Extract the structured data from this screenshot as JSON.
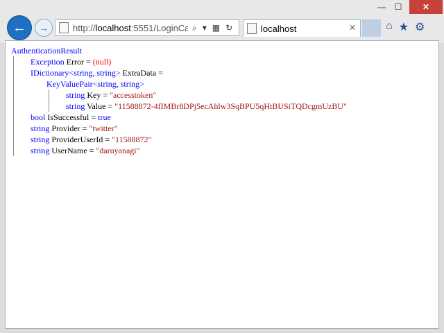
{
  "window": {
    "minimize_label": "—",
    "maximize_label": "☐",
    "close_label": "✕"
  },
  "nav": {
    "back_icon": "←",
    "forward_icon": "→",
    "address_prefix": "http://",
    "address_host": "localhost",
    "address_rest": ":5551/LoginCa",
    "search_icon": "⌕",
    "dropdown_icon": "▾",
    "compat_icon": "▦",
    "refresh_icon": "↻"
  },
  "tab": {
    "label": "localhost",
    "close_icon": "✕"
  },
  "toolbar": {
    "home_icon": "⌂",
    "favorites_icon": "★",
    "settings_icon": "⚙"
  },
  "content": {
    "root": "AuthenticationResult",
    "lines": {
      "exception": {
        "type": "Exception",
        "name": " Error = ",
        "value": "(null)"
      },
      "extradata": {
        "type": "IDictionary",
        "generic": "<string, string>",
        "rest": " ExtraData ="
      },
      "kvp": {
        "type": "KeyValuePair",
        "generic": "<string, string>"
      },
      "key": {
        "type": "string",
        "name": " Key = ",
        "value": "\"accesstoken\""
      },
      "value": {
        "type": "string",
        "name": " Value = ",
        "value": "\"11588872-4fIMBr8DPj5ecAhlw3SqBPU5qHtBUSiTQDcgmUzBU\""
      },
      "issuccessful": {
        "type": "bool",
        "name": " IsSuccessful = ",
        "value": "true"
      },
      "provider": {
        "type": "string",
        "name": " Provider = ",
        "value": "\"twitter\""
      },
      "provideruserid": {
        "type": "string",
        "name": " ProviderUserId = ",
        "value": "\"11588872\""
      },
      "username": {
        "type": "string",
        "name": " UserName = ",
        "value": "\"daruyanagi\""
      }
    }
  }
}
